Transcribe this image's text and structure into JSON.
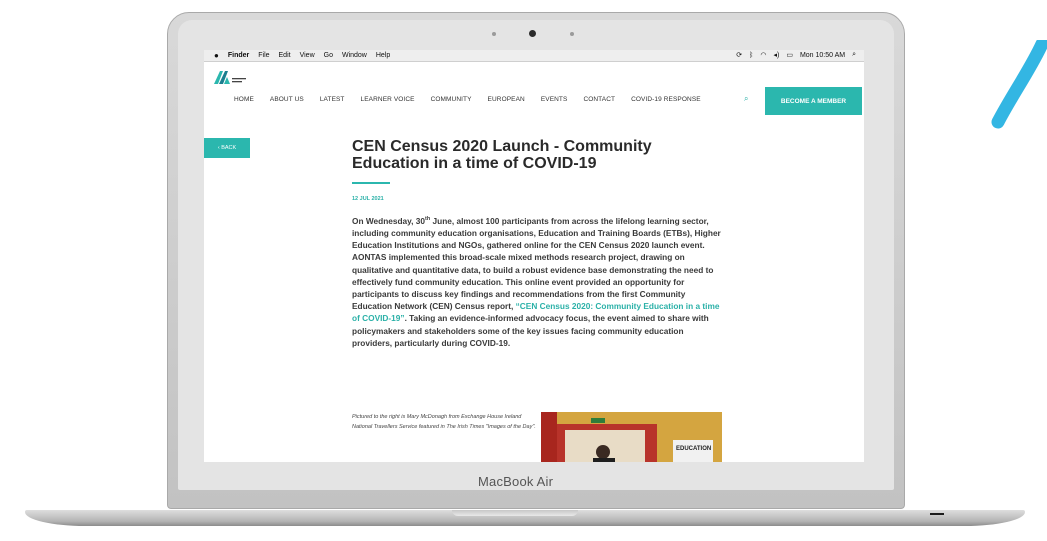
{
  "menubar": {
    "apple": "",
    "items": [
      "Finder",
      "File",
      "Edit",
      "View",
      "Go",
      "Window",
      "Help"
    ],
    "clock": "Mon 10:50 AM"
  },
  "site": {
    "logo_text": "The Voice of Adult Learning",
    "nav": [
      "HOME",
      "ABOUT US",
      "LATEST",
      "LEARNER VOICE",
      "COMMUNITY",
      "EUROPEAN",
      "EVENTS",
      "CONTACT",
      "COVID-19 RESPONSE"
    ],
    "member_button": "BECOME A MEMBER",
    "back_button": "‹ BACK",
    "accent_color": "#2bb7ae"
  },
  "article": {
    "title": "CEN Census 2020 Launch - Community Education in a time of COVID-19",
    "date": "12 JUL 2021",
    "body_part1": "On Wednesday, 30",
    "body_sup": "th",
    "body_part2": " June, almost 100 participants from across the lifelong learning sector, including community education organisations, Education and Training Boards (ETBs), Higher Education Institutions and NGOs, gathered online for the CEN Census 2020 launch event. AONTAS implemented this broad-scale mixed methods research project, drawing on qualitative and quantitative data, to build a robust evidence base demonstrating the need to effectively fund community education. This online event provided an opportunity for participants to discuss key findings and recommendations from the first Community Education Network (CEN) Census report, ",
    "body_link": "“CEN Census 2020: Community Education in a time of COVID-19”",
    "body_part3": ". Taking an evidence-informed advocacy focus, the event aimed to share with policymakers and stakeholders some of the key issues facing community education providers, particularly during COVID-19.",
    "caption": "Pictured to the right is Mary McDonagh from Exchange House Ireland National Travellers Service featured in The Irish Times \"Images of the Day\".",
    "photo_sign": "EDUCATION"
  },
  "device_label": "MacBook Air"
}
